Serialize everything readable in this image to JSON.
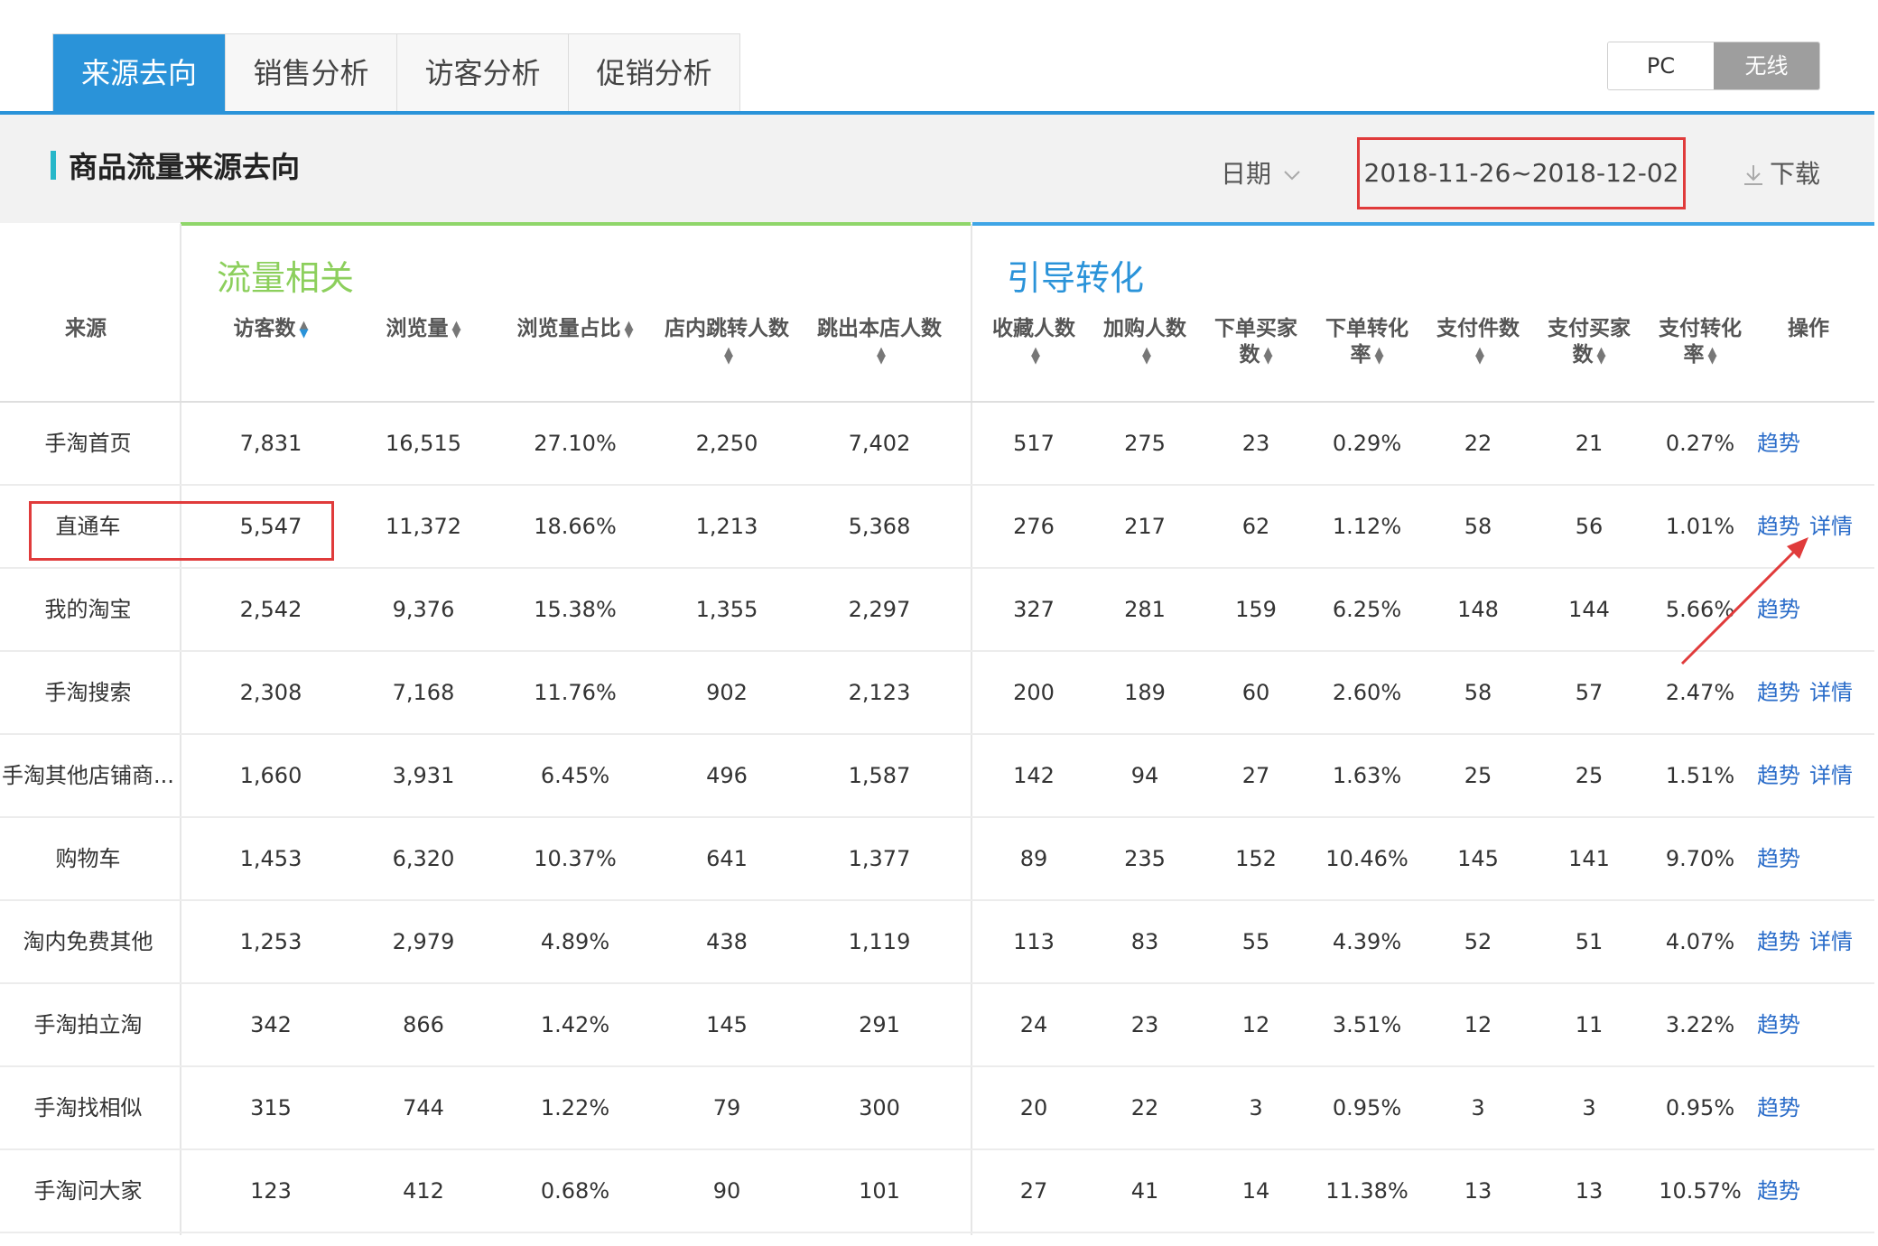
{
  "tabs": [
    {
      "label": "来源去向",
      "active": true
    },
    {
      "label": "销售分析",
      "active": false
    },
    {
      "label": "访客分析",
      "active": false
    },
    {
      "label": "促销分析",
      "active": false
    }
  ],
  "device_toggle": {
    "pc": "PC",
    "wireless": "无线",
    "selected": "无线"
  },
  "header": {
    "title": "商品流量来源去向",
    "date_label": "日期",
    "date_range": "2018-11-26~2018-12-02",
    "download_label": "下载"
  },
  "groups": {
    "traffic": "流量相关",
    "conversion": "引导转化"
  },
  "columns": {
    "source": "来源",
    "visitors": "访客数",
    "pageviews": "浏览量",
    "pv_share": "浏览量占比",
    "store_jump": "店内跳转人数",
    "exit_store": "跳出本店人数",
    "favorites": "收藏人数",
    "add_cart": "加购人数",
    "order_buyers_1": "下单买家",
    "order_buyers_2": "数",
    "order_conv_1": "下单转化",
    "order_conv_2": "率",
    "pay_items": "支付件数",
    "pay_buyers_1": "支付买家",
    "pay_buyers_2": "数",
    "pay_conv_1": "支付转化",
    "pay_conv_2": "率",
    "actions": "操作"
  },
  "actions": {
    "trend": "趋势",
    "detail": "详情"
  },
  "rows": [
    {
      "source": "手淘首页",
      "visitors": "7,831",
      "pageviews": "16,515",
      "pv_share": "27.10%",
      "store_jump": "2,250",
      "exit_store": "7,402",
      "favorites": "517",
      "add_cart": "275",
      "order_buyers": "23",
      "order_conv": "0.29%",
      "pay_items": "22",
      "pay_buyers": "21",
      "pay_conv": "0.27%",
      "has_detail": false
    },
    {
      "source": "直通车",
      "visitors": "5,547",
      "pageviews": "11,372",
      "pv_share": "18.66%",
      "store_jump": "1,213",
      "exit_store": "5,368",
      "favorites": "276",
      "add_cart": "217",
      "order_buyers": "62",
      "order_conv": "1.12%",
      "pay_items": "58",
      "pay_buyers": "56",
      "pay_conv": "1.01%",
      "has_detail": true
    },
    {
      "source": "我的淘宝",
      "visitors": "2,542",
      "pageviews": "9,376",
      "pv_share": "15.38%",
      "store_jump": "1,355",
      "exit_store": "2,297",
      "favorites": "327",
      "add_cart": "281",
      "order_buyers": "159",
      "order_conv": "6.25%",
      "pay_items": "148",
      "pay_buyers": "144",
      "pay_conv": "5.66%",
      "has_detail": false
    },
    {
      "source": "手淘搜索",
      "visitors": "2,308",
      "pageviews": "7,168",
      "pv_share": "11.76%",
      "store_jump": "902",
      "exit_store": "2,123",
      "favorites": "200",
      "add_cart": "189",
      "order_buyers": "60",
      "order_conv": "2.60%",
      "pay_items": "58",
      "pay_buyers": "57",
      "pay_conv": "2.47%",
      "has_detail": true
    },
    {
      "source": "手淘其他店铺商...",
      "visitors": "1,660",
      "pageviews": "3,931",
      "pv_share": "6.45%",
      "store_jump": "496",
      "exit_store": "1,587",
      "favorites": "142",
      "add_cart": "94",
      "order_buyers": "27",
      "order_conv": "1.63%",
      "pay_items": "25",
      "pay_buyers": "25",
      "pay_conv": "1.51%",
      "has_detail": true
    },
    {
      "source": "购物车",
      "visitors": "1,453",
      "pageviews": "6,320",
      "pv_share": "10.37%",
      "store_jump": "641",
      "exit_store": "1,377",
      "favorites": "89",
      "add_cart": "235",
      "order_buyers": "152",
      "order_conv": "10.46%",
      "pay_items": "145",
      "pay_buyers": "141",
      "pay_conv": "9.70%",
      "has_detail": false
    },
    {
      "source": "淘内免费其他",
      "visitors": "1,253",
      "pageviews": "2,979",
      "pv_share": "4.89%",
      "store_jump": "438",
      "exit_store": "1,119",
      "favorites": "113",
      "add_cart": "83",
      "order_buyers": "55",
      "order_conv": "4.39%",
      "pay_items": "52",
      "pay_buyers": "51",
      "pay_conv": "4.07%",
      "has_detail": true
    },
    {
      "source": "手淘拍立淘",
      "visitors": "342",
      "pageviews": "866",
      "pv_share": "1.42%",
      "store_jump": "145",
      "exit_store": "291",
      "favorites": "24",
      "add_cart": "23",
      "order_buyers": "12",
      "order_conv": "3.51%",
      "pay_items": "12",
      "pay_buyers": "11",
      "pay_conv": "3.22%",
      "has_detail": false
    },
    {
      "source": "手淘找相似",
      "visitors": "315",
      "pageviews": "744",
      "pv_share": "1.22%",
      "store_jump": "79",
      "exit_store": "300",
      "favorites": "20",
      "add_cart": "22",
      "order_buyers": "3",
      "order_conv": "0.95%",
      "pay_items": "3",
      "pay_buyers": "3",
      "pay_conv": "0.95%",
      "has_detail": false
    },
    {
      "source": "手淘问大家",
      "visitors": "123",
      "pageviews": "412",
      "pv_share": "0.68%",
      "store_jump": "90",
      "exit_store": "101",
      "favorites": "27",
      "add_cart": "41",
      "order_buyers": "14",
      "order_conv": "11.38%",
      "pay_items": "13",
      "pay_buyers": "13",
      "pay_conv": "10.57%",
      "has_detail": false
    }
  ]
}
